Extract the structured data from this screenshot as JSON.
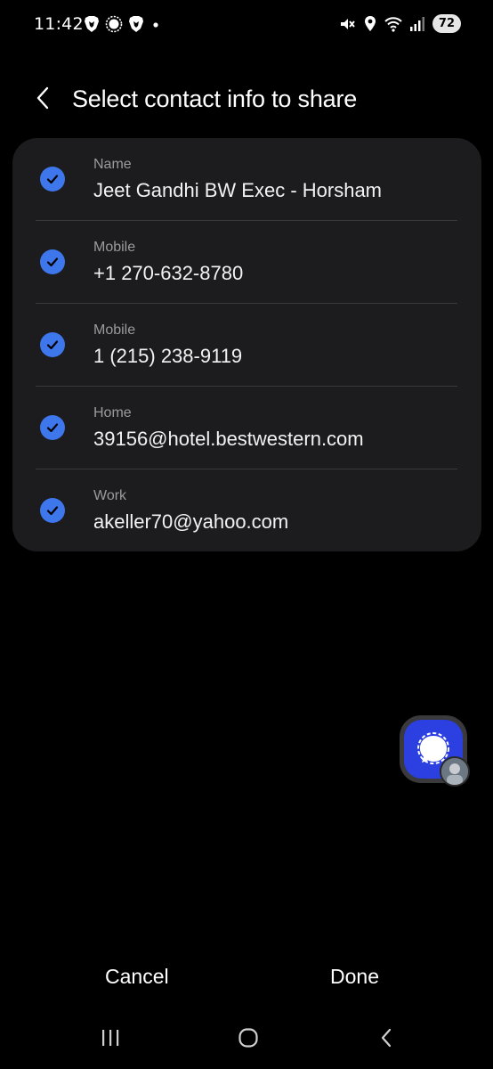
{
  "status_bar": {
    "time": "11:42",
    "battery": "72",
    "left_icons": [
      "brave-icon",
      "signal-app-icon",
      "brave-icon",
      "dot-icon"
    ],
    "right_icons": [
      "mute-icon",
      "location-icon",
      "wifi-icon",
      "cell-signal-icon"
    ]
  },
  "header": {
    "title": "Select contact info to share"
  },
  "contact_fields": [
    {
      "label": "Name",
      "value": "Jeet Gandhi BW Exec - Horsham",
      "checked": true
    },
    {
      "label": "Mobile",
      "value": "+1 270-632-8780",
      "checked": true
    },
    {
      "label": "Mobile",
      "value": "1 (215) 238-9119",
      "checked": true
    },
    {
      "label": "Home",
      "value": "39156@hotel.bestwestern.com",
      "checked": true
    },
    {
      "label": "Work",
      "value": "akeller70@yahoo.com",
      "checked": true
    }
  ],
  "actions": {
    "cancel": "Cancel",
    "done": "Done"
  },
  "colors": {
    "background": "#000000",
    "card": "#1c1c1e",
    "check_accent": "#3e76ec",
    "bubble_accent": "#2c3fe0",
    "label_gray": "#9b9b9b"
  }
}
